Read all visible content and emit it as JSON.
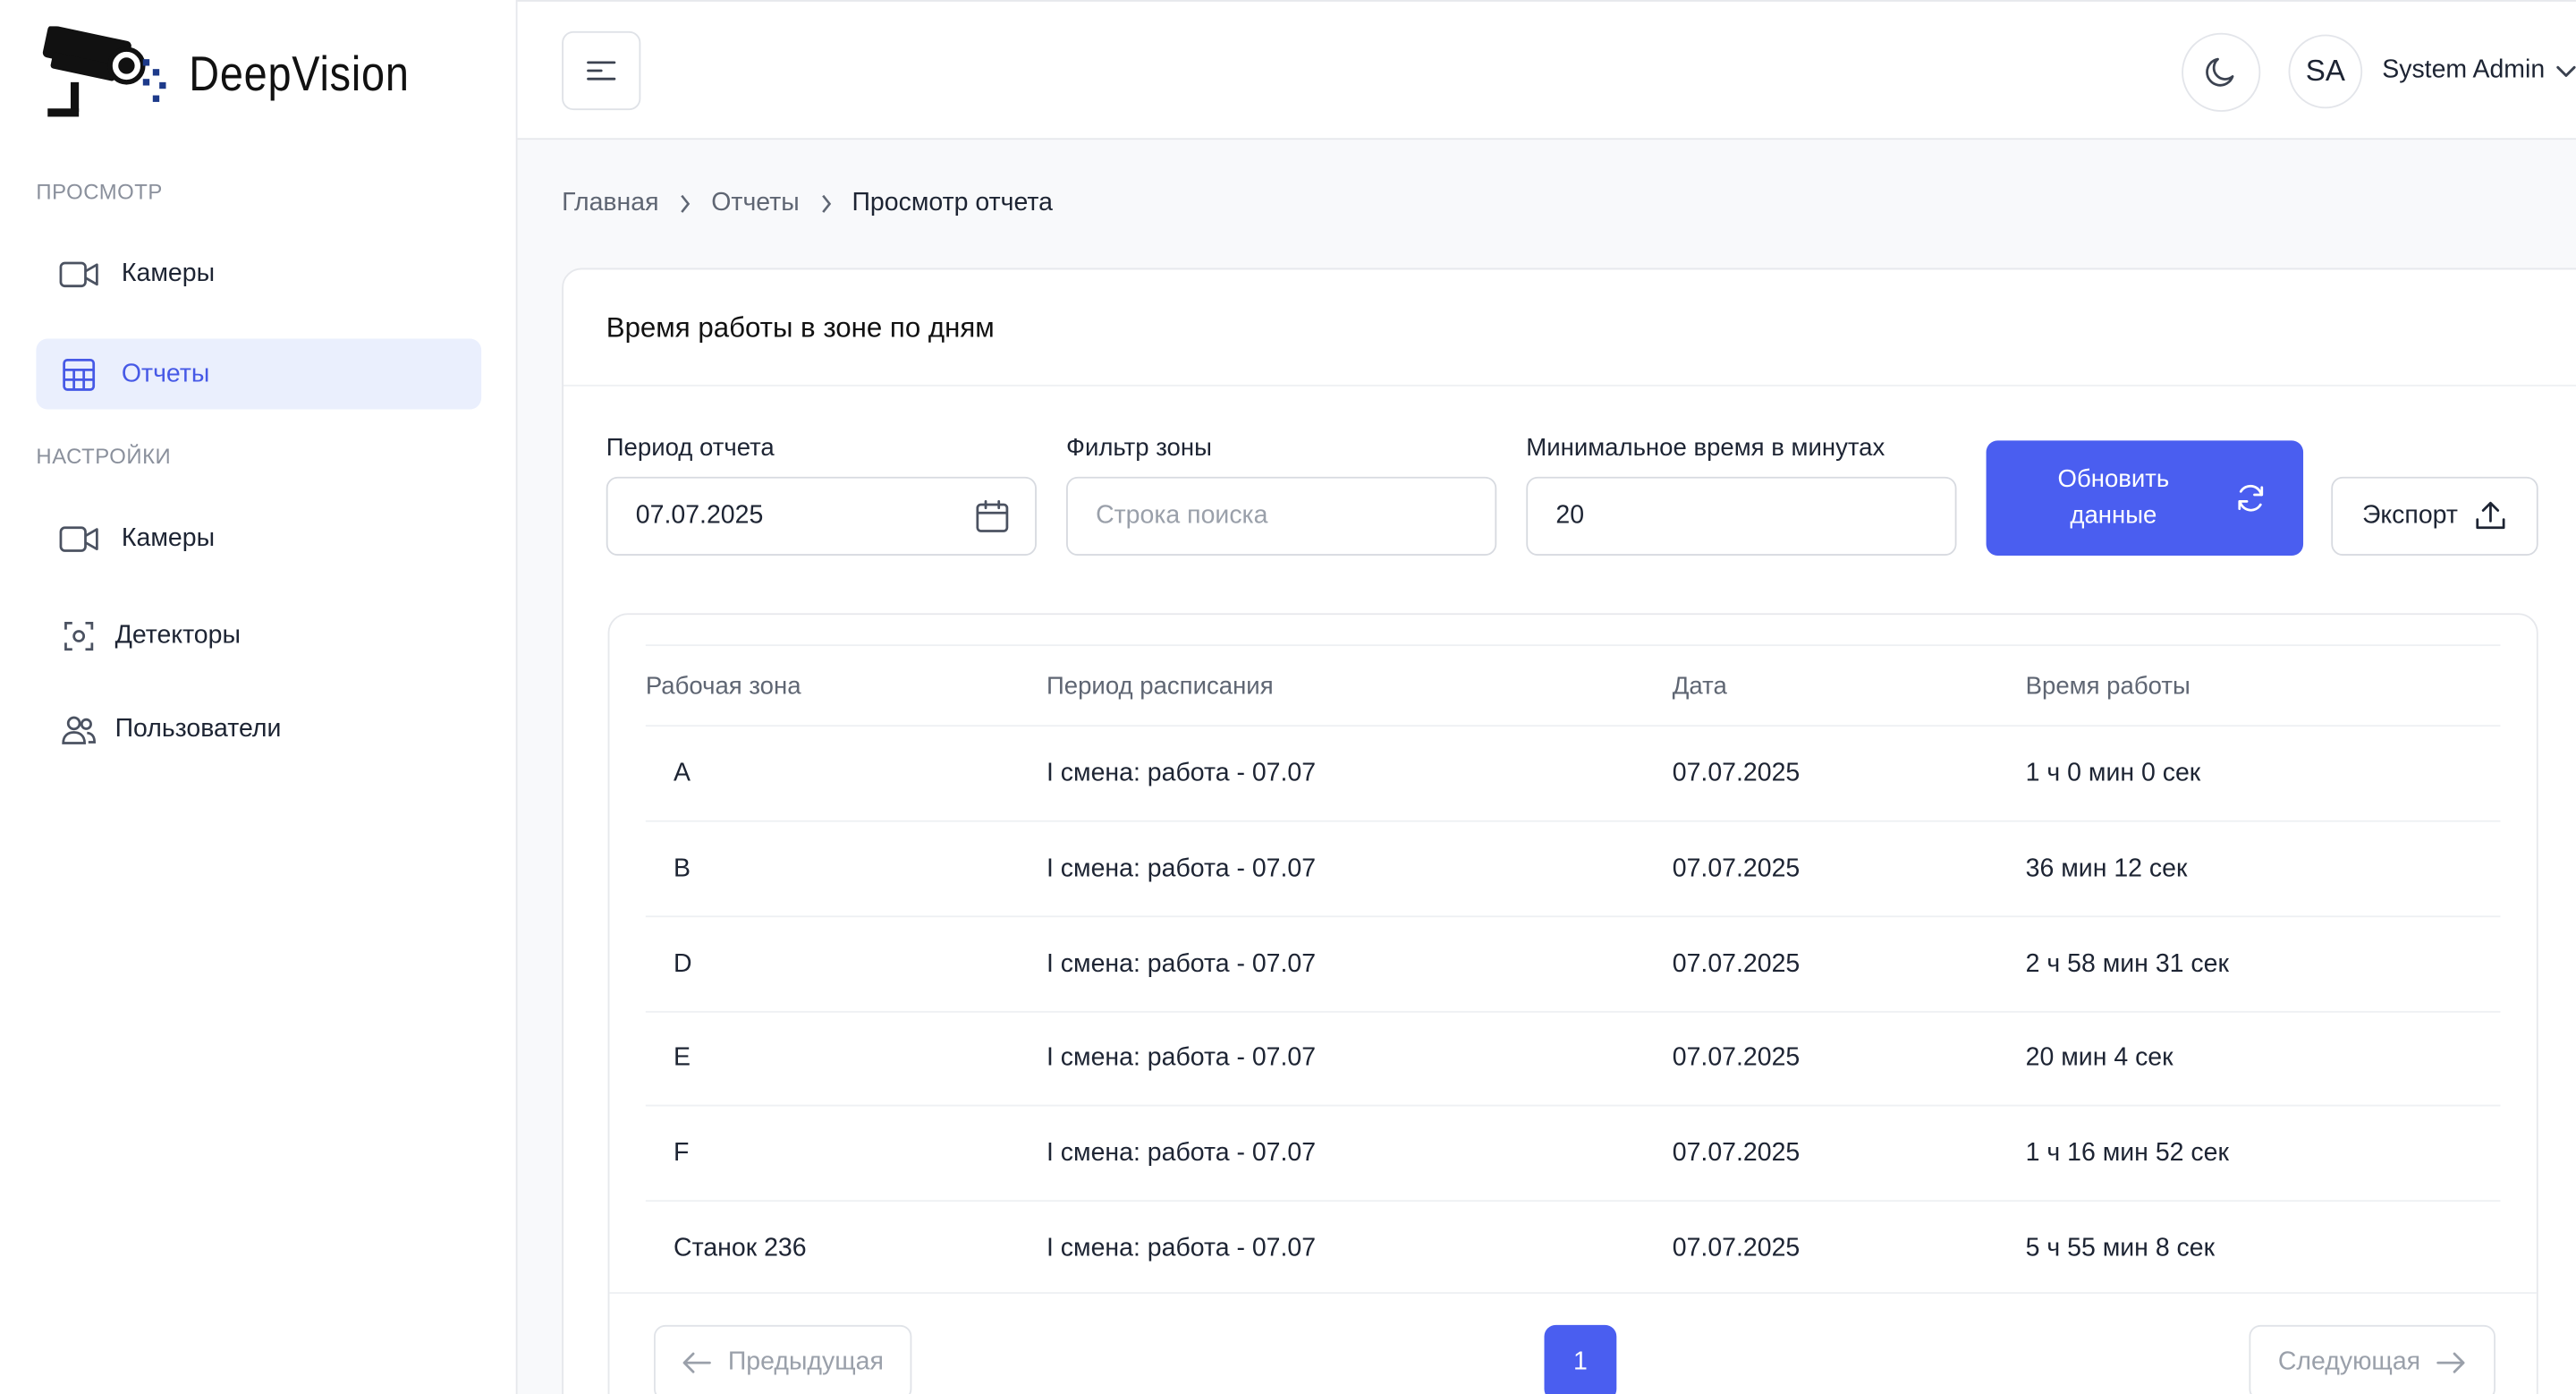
{
  "app": {
    "name": "DeepVision"
  },
  "sidebar": {
    "sections": [
      {
        "label": "ПРОСМОТР",
        "items": [
          {
            "label": "Камеры",
            "icon": "video-camera-icon",
            "active": false
          },
          {
            "label": "Отчеты",
            "icon": "table-grid-icon",
            "active": true
          }
        ]
      },
      {
        "label": "НАСТРОЙКИ",
        "items": [
          {
            "label": "Камеры",
            "icon": "video-camera-icon",
            "active": false
          },
          {
            "label": "Детекторы",
            "icon": "detector-focus-icon",
            "active": false
          },
          {
            "label": "Пользователи",
            "icon": "users-icon",
            "active": false
          }
        ]
      }
    ]
  },
  "header": {
    "avatar_initials": "SA",
    "user_name": "System Admin"
  },
  "breadcrumb": [
    "Главная",
    "Отчеты",
    "Просмотр отчета"
  ],
  "report": {
    "title": "Время работы в зоне по дням",
    "filters": {
      "period_label": "Период отчета",
      "period_value": "07.07.2025",
      "zone_label": "Фильтр зоны",
      "zone_placeholder": "Строка поиска",
      "min_time_label": "Минимальное время в минутах",
      "min_time_value": "20"
    },
    "refresh_label": "Обновить данные",
    "export_label": "Экспорт",
    "columns": [
      "Рабочая зона",
      "Период расписания",
      "Дата",
      "Время работы"
    ],
    "rows": [
      {
        "zone": "A",
        "period": "I смена: работа - 07.07",
        "date": "07.07.2025",
        "time": "1 ч 0 мин 0 сек"
      },
      {
        "zone": "B",
        "period": "I смена: работа - 07.07",
        "date": "07.07.2025",
        "time": "36 мин 12 сек"
      },
      {
        "zone": "D",
        "period": "I смена: работа - 07.07",
        "date": "07.07.2025",
        "time": "2 ч 58 мин 31 сек"
      },
      {
        "zone": "E",
        "period": "I смена: работа - 07.07",
        "date": "07.07.2025",
        "time": "20 мин 4 сек"
      },
      {
        "zone": "F",
        "period": "I смена: работа - 07.07",
        "date": "07.07.2025",
        "time": "1 ч 16 мин 52 сек"
      },
      {
        "zone": "Станок 236",
        "period": "I смена: работа - 07.07",
        "date": "07.07.2025",
        "time": "5 ч 55 мин 8 сек"
      }
    ],
    "pagination": {
      "prev_label": "Предыдущая",
      "current_page": "1",
      "next_label": "Следующая"
    }
  },
  "colors": {
    "accent": "#4a5ef0",
    "active_bg": "#eaeffd",
    "active_text": "#4659e6"
  }
}
